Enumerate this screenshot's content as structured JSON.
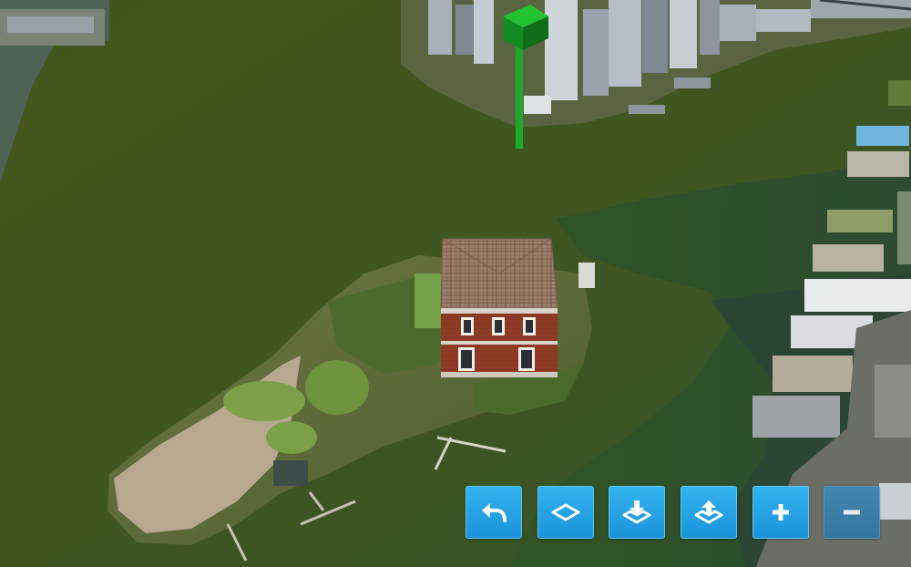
{
  "map": {
    "view": "aerial-3d",
    "water_color": "#44561d",
    "shallow_water_color": "#2a4a26",
    "marker_color": "#1bab2a",
    "building_roof": "roof-tile"
  },
  "toolbar": {
    "accent_color": "#1fa1e4",
    "buttons": [
      {
        "id": "undo",
        "icon": "undo-arrow-icon",
        "enabled": true
      },
      {
        "id": "draw-area",
        "icon": "diamond-outline-icon",
        "enabled": true
      },
      {
        "id": "lower",
        "icon": "download-tray-icon",
        "enabled": true
      },
      {
        "id": "raise",
        "icon": "upload-tray-icon",
        "enabled": true
      },
      {
        "id": "zoom-in",
        "icon": "plus-icon",
        "enabled": true
      },
      {
        "id": "zoom-out",
        "icon": "minus-icon",
        "enabled": false
      }
    ]
  }
}
